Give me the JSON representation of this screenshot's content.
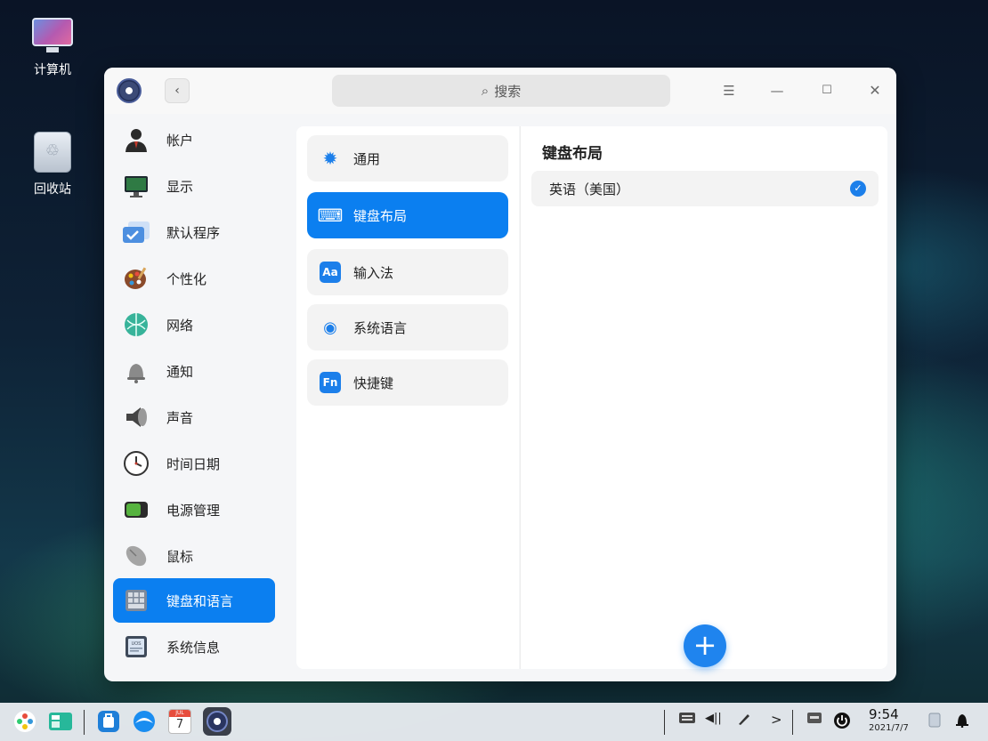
{
  "desktop": {
    "computer_label": "计算机",
    "trash_label": "回收站"
  },
  "titlebar": {
    "back_glyph": "‹",
    "search_placeholder": "搜索",
    "search_icon": "⌕",
    "menu_glyph": "☰",
    "minimize_glyph": "—",
    "maximize_glyph": "☐",
    "close_glyph": "✕"
  },
  "sidebar": {
    "items": [
      {
        "label": "帐户",
        "icon": "account-icon",
        "color": "#2a2a2a"
      },
      {
        "label": "显示",
        "icon": "display-icon",
        "color": "#2f7a44"
      },
      {
        "label": "默认程序",
        "icon": "default-apps-icon",
        "color": "#4d8fe0"
      },
      {
        "label": "个性化",
        "icon": "personalization-icon",
        "color": "#c0563a"
      },
      {
        "label": "网络",
        "icon": "network-icon",
        "color": "#37b39a"
      },
      {
        "label": "通知",
        "icon": "bell-icon",
        "color": "#8a8a8a"
      },
      {
        "label": "声音",
        "icon": "speaker-icon",
        "color": "#555555"
      },
      {
        "label": "时间日期",
        "icon": "clock-icon",
        "color": "#333333"
      },
      {
        "label": "电源管理",
        "icon": "battery-icon",
        "color": "#4fa53a"
      },
      {
        "label": "鼠标",
        "icon": "mouse-icon",
        "color": "#9a9a9a"
      },
      {
        "label": "键盘和语言",
        "icon": "keyboard-language-icon",
        "color": "#ffffff",
        "active": true
      },
      {
        "label": "系统信息",
        "icon": "system-info-icon",
        "color": "#3f4a5a"
      }
    ]
  },
  "middle": {
    "items": [
      {
        "label": "通用",
        "icon": "gear-icon",
        "glyph": "✹",
        "color": "#1c7fea"
      },
      {
        "label": "键盘布局",
        "icon": "keyboard-icon",
        "glyph": "⌨",
        "color": "#ffffff",
        "active": true
      },
      {
        "label": "输入法",
        "icon": "input-method-icon",
        "glyph": "Aa",
        "color": "#1c7fea"
      },
      {
        "label": "系统语言",
        "icon": "globe-icon",
        "glyph": "◉",
        "color": "#1c7fea"
      },
      {
        "label": "快捷键",
        "icon": "fn-key-icon",
        "glyph": "Fn",
        "color": "#1c7fea"
      }
    ]
  },
  "right": {
    "title": "键盘布局",
    "layouts": [
      {
        "label": "英语（美国）",
        "selected": true
      }
    ],
    "check_glyph": "✓",
    "add_glyph": "+"
  },
  "taskbar": {
    "time": "9:54",
    "date": "2021/7/7",
    "calendar_day": "7",
    "calendar_month": "JUL",
    "arrow_glyph": ">",
    "volume_glyph": "◀||",
    "bell_glyph": "🔔"
  },
  "colors": {
    "accent": "#0b7ff0",
    "window_bg": "#f5f6f8",
    "panel_bg": "#ffffff"
  }
}
